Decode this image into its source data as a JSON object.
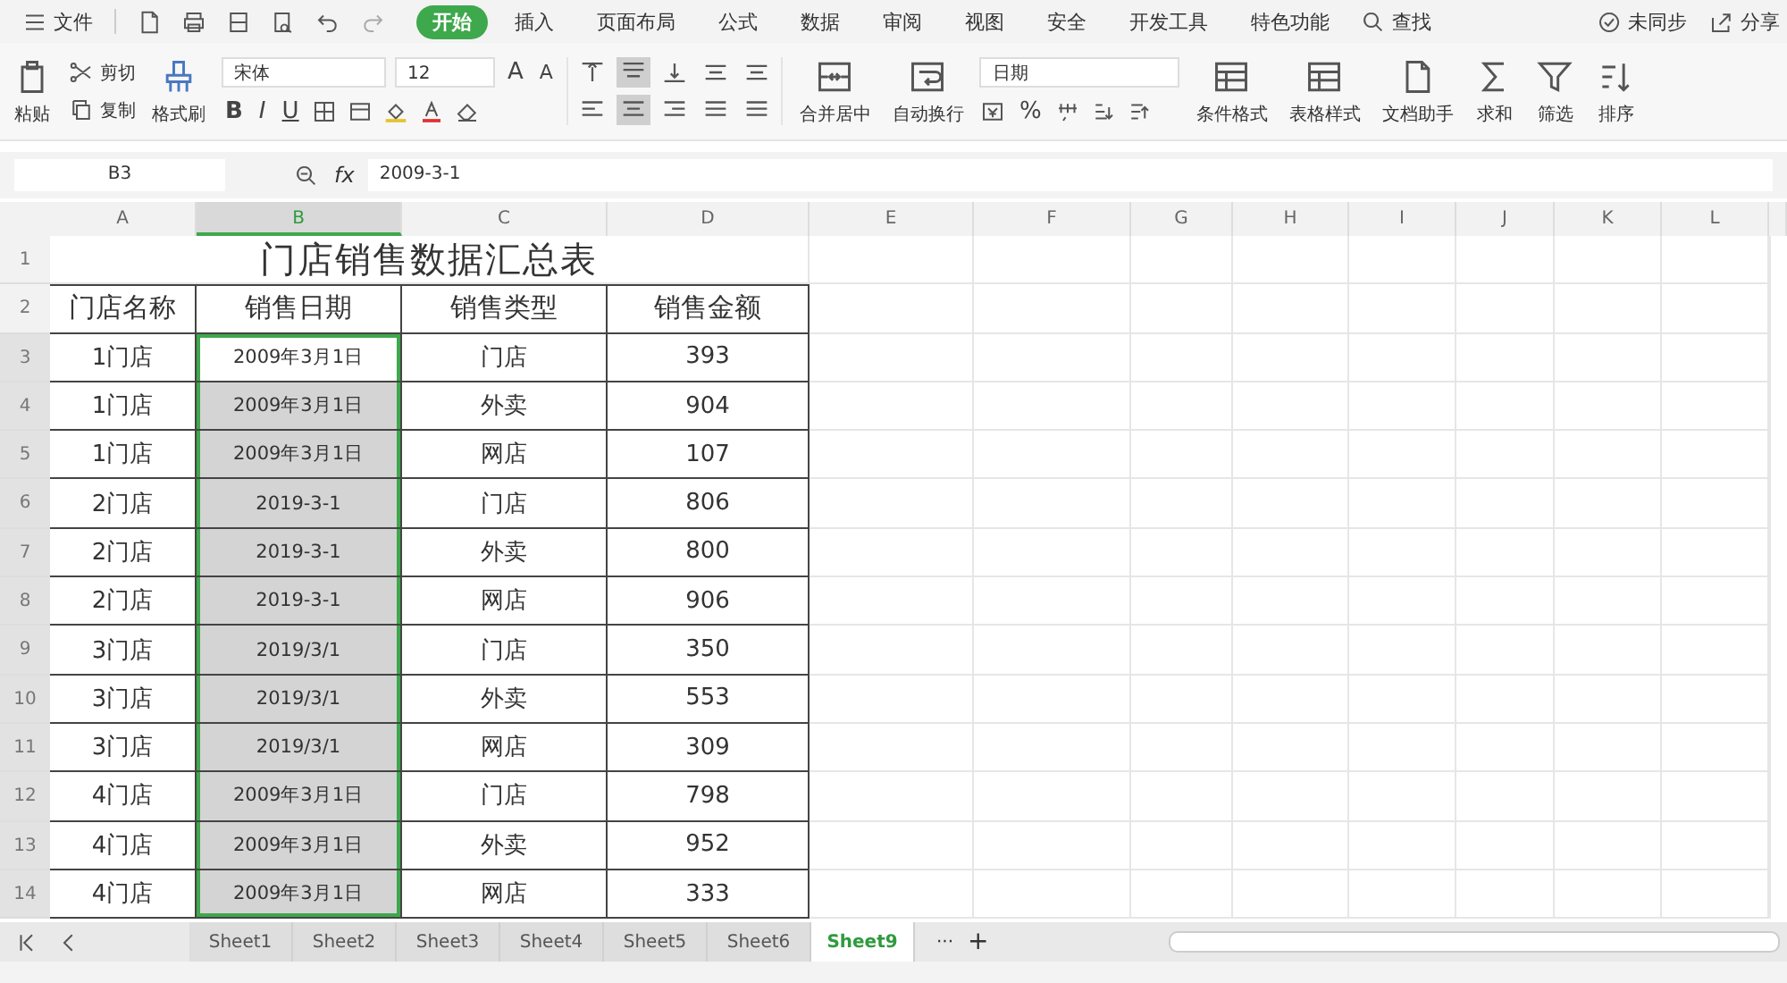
{
  "menu": {
    "label": "文件"
  },
  "tabs": [
    {
      "label": "开始",
      "selected": true
    },
    {
      "label": "插入",
      "selected": false
    },
    {
      "label": "页面布局",
      "selected": false
    },
    {
      "label": "公式",
      "selected": false
    },
    {
      "label": "数据",
      "selected": false
    },
    {
      "label": "审阅",
      "selected": false
    },
    {
      "label": "视图",
      "selected": false
    },
    {
      "label": "安全",
      "selected": false
    },
    {
      "label": "开发工具",
      "selected": false
    },
    {
      "label": "特色功能",
      "selected": false
    }
  ],
  "search": {
    "label": "查找"
  },
  "sync": {
    "label": "未同步"
  },
  "share": {
    "label": "分享"
  },
  "ribbon": {
    "paste": "粘贴",
    "cut": "剪切",
    "copy": "复制",
    "format_painter": "格式刷",
    "font": "宋体",
    "font_size": "12",
    "font_grow": "A",
    "font_shrink": "A",
    "font_styles": [
      "B",
      "I",
      "U"
    ],
    "align_buttons": [
      {
        "selected": false
      },
      {
        "selected": true
      },
      {
        "selected": false
      },
      {
        "selected": false
      },
      {
        "selected": false
      },
      {
        "selected": false
      },
      {
        "selected": true
      },
      {
        "selected": false
      },
      {
        "selected": false
      },
      {
        "selected": false
      }
    ],
    "merge": "合并居中",
    "wrap": "自动换行",
    "number_format": "日期",
    "percent": "%",
    "conditional_format": "条件格式",
    "table_style": "表格样式",
    "doc_assistant": "文档助手",
    "sum": "求和",
    "filter": "筛选",
    "sort": "排序"
  },
  "name_box": "B3",
  "fx_label": "fx",
  "formula": "2009-3-1",
  "columns": [
    {
      "label": "A",
      "selected": false
    },
    {
      "label": "B",
      "selected": true
    },
    {
      "label": "C",
      "selected": false
    },
    {
      "label": "D",
      "selected": false
    },
    {
      "label": "E",
      "selected": false
    },
    {
      "label": "F",
      "selected": false
    },
    {
      "label": "G",
      "selected": false
    },
    {
      "label": "H",
      "selected": false
    },
    {
      "label": "I",
      "selected": false
    },
    {
      "label": "J",
      "selected": false
    },
    {
      "label": "K",
      "selected": false
    },
    {
      "label": "L",
      "selected": false
    }
  ],
  "rows": [
    {
      "number": "1",
      "kind": "title",
      "selected": false,
      "title": "门店销售数据汇总表"
    },
    {
      "number": "2",
      "kind": "header",
      "selected": false,
      "cells": [
        {
          "text": "门店名称",
          "selected": false,
          "active": false
        },
        {
          "text": "销售日期",
          "selected": false,
          "active": false
        },
        {
          "text": "销售类型",
          "selected": false,
          "active": false
        },
        {
          "text": "销售金额",
          "selected": false,
          "active": false
        }
      ]
    },
    {
      "number": "3",
      "kind": "data",
      "selected": true,
      "cells": [
        {
          "text": "1门店",
          "selected": false,
          "active": false
        },
        {
          "text": "2009年3月1日",
          "selected": true,
          "active": true
        },
        {
          "text": "门店",
          "selected": false,
          "active": false
        },
        {
          "text": "393",
          "selected": false,
          "active": false
        }
      ]
    },
    {
      "number": "4",
      "kind": "data",
      "selected": true,
      "cells": [
        {
          "text": "1门店",
          "selected": false,
          "active": false
        },
        {
          "text": "2009年3月1日",
          "selected": true,
          "active": false
        },
        {
          "text": "外卖",
          "selected": false,
          "active": false
        },
        {
          "text": "904",
          "selected": false,
          "active": false
        }
      ]
    },
    {
      "number": "5",
      "kind": "data",
      "selected": true,
      "cells": [
        {
          "text": "1门店",
          "selected": false,
          "active": false
        },
        {
          "text": "2009年3月1日",
          "selected": true,
          "active": false
        },
        {
          "text": "网店",
          "selected": false,
          "active": false
        },
        {
          "text": "107",
          "selected": false,
          "active": false
        }
      ]
    },
    {
      "number": "6",
      "kind": "data",
      "selected": true,
      "cells": [
        {
          "text": "2门店",
          "selected": false,
          "active": false
        },
        {
          "text": "2019-3-1",
          "selected": true,
          "active": false
        },
        {
          "text": "门店",
          "selected": false,
          "active": false
        },
        {
          "text": "806",
          "selected": false,
          "active": false
        }
      ]
    },
    {
      "number": "7",
      "kind": "data",
      "selected": true,
      "cells": [
        {
          "text": "2门店",
          "selected": false,
          "active": false
        },
        {
          "text": "2019-3-1",
          "selected": true,
          "active": false
        },
        {
          "text": "外卖",
          "selected": false,
          "active": false
        },
        {
          "text": "800",
          "selected": false,
          "active": false
        }
      ]
    },
    {
      "number": "8",
      "kind": "data",
      "selected": true,
      "cells": [
        {
          "text": "2门店",
          "selected": false,
          "active": false
        },
        {
          "text": "2019-3-1",
          "selected": true,
          "active": false
        },
        {
          "text": "网店",
          "selected": false,
          "active": false
        },
        {
          "text": "906",
          "selected": false,
          "active": false
        }
      ]
    },
    {
      "number": "9",
      "kind": "data",
      "selected": true,
      "cells": [
        {
          "text": "3门店",
          "selected": false,
          "active": false
        },
        {
          "text": "2019/3/1",
          "selected": true,
          "active": false
        },
        {
          "text": "门店",
          "selected": false,
          "active": false
        },
        {
          "text": "350",
          "selected": false,
          "active": false
        }
      ]
    },
    {
      "number": "10",
      "kind": "data",
      "selected": true,
      "cells": [
        {
          "text": "3门店",
          "selected": false,
          "active": false
        },
        {
          "text": "2019/3/1",
          "selected": true,
          "active": false
        },
        {
          "text": "外卖",
          "selected": false,
          "active": false
        },
        {
          "text": "553",
          "selected": false,
          "active": false
        }
      ]
    },
    {
      "number": "11",
      "kind": "data",
      "selected": true,
      "cells": [
        {
          "text": "3门店",
          "selected": false,
          "active": false
        },
        {
          "text": "2019/3/1",
          "selected": true,
          "active": false
        },
        {
          "text": "网店",
          "selected": false,
          "active": false
        },
        {
          "text": "309",
          "selected": false,
          "active": false
        }
      ]
    },
    {
      "number": "12",
      "kind": "data",
      "selected": true,
      "cells": [
        {
          "text": "4门店",
          "selected": false,
          "active": false
        },
        {
          "text": "2009年3月1日",
          "selected": true,
          "active": false
        },
        {
          "text": "门店",
          "selected": false,
          "active": false
        },
        {
          "text": "798",
          "selected": false,
          "active": false
        }
      ]
    },
    {
      "number": "13",
      "kind": "data",
      "selected": true,
      "cells": [
        {
          "text": "4门店",
          "selected": false,
          "active": false
        },
        {
          "text": "2009年3月1日",
          "selected": true,
          "active": false
        },
        {
          "text": "外卖",
          "selected": false,
          "active": false
        },
        {
          "text": "952",
          "selected": false,
          "active": false
        }
      ]
    },
    {
      "number": "14",
      "kind": "data",
      "selected": true,
      "cells": [
        {
          "text": "4门店",
          "selected": false,
          "active": false
        },
        {
          "text": "2009年3月1日",
          "selected": true,
          "active": false
        },
        {
          "text": "网店",
          "selected": false,
          "active": false
        },
        {
          "text": "333",
          "selected": false,
          "active": false
        }
      ]
    }
  ],
  "sheet_tabs": [
    {
      "label": "Sheet1",
      "selected": false
    },
    {
      "label": "Sheet2",
      "selected": false
    },
    {
      "label": "Sheet3",
      "selected": false
    },
    {
      "label": "Sheet4",
      "selected": false
    },
    {
      "label": "Sheet5",
      "selected": false
    },
    {
      "label": "Sheet6",
      "selected": false
    },
    {
      "label": "Sheet9",
      "selected": true
    }
  ],
  "sheet_more": "···",
  "sheet_add": "+"
}
